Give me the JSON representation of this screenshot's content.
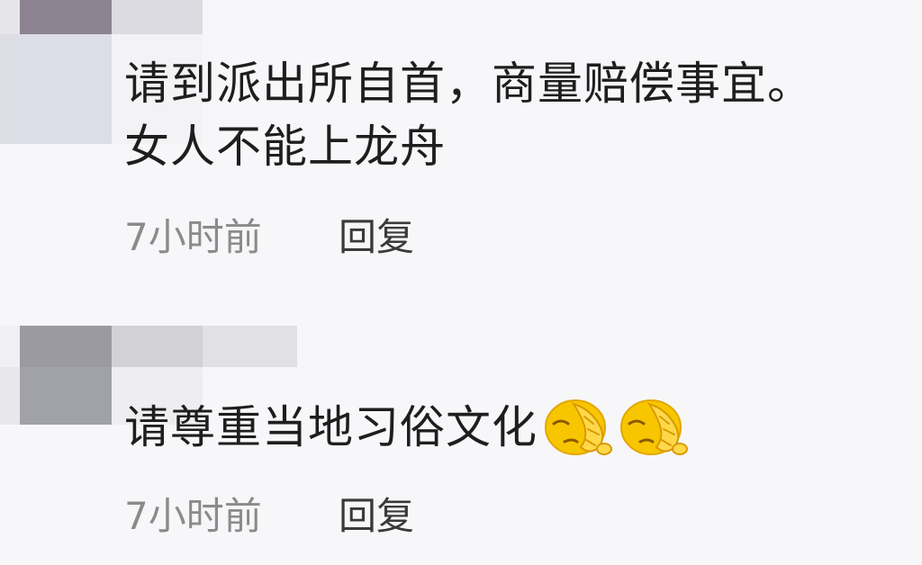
{
  "comments": [
    {
      "text": "请到派出所自首，商量赔偿事宜。",
      "text_line2": "女人不能上龙舟",
      "time": "7小时前",
      "reply_label": "回复"
    },
    {
      "text": "请尊重当地习俗文化",
      "emojis": [
        "facepalm-emoji",
        "facepalm-emoji"
      ],
      "time": "7小时前",
      "reply_label": "回复"
    }
  ],
  "colors": {
    "background": "#f7f7fa",
    "comment_text": "#1e1e1e",
    "timestamp": "#8b8b8b",
    "reply": "#3a3a3a",
    "emoji_yellow": "#f7c600"
  }
}
